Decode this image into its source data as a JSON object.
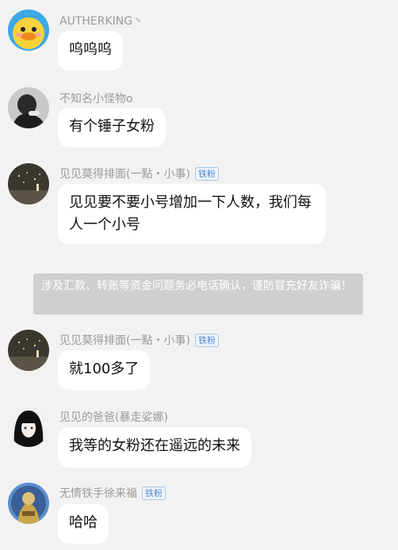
{
  "messages": [
    {
      "name": "AUTHERKING丶",
      "badge": "",
      "text": "呜呜呜",
      "avatar": "duck-avatar"
    },
    {
      "name": "不知名小怪物o",
      "badge": "",
      "text": "有个锤子女粉",
      "avatar": "hooded-person-avatar"
    },
    {
      "name": "见见莫得排面(一點・小事)",
      "badge": "铁粉",
      "text": "见见要不要小号增加一下人数，我们每人一个小号",
      "avatar": "dark-night-avatar"
    },
    {
      "name": "见见莫得排面(一點・小事)",
      "badge": "铁粉",
      "text": "就100多了",
      "avatar": "dark-night-avatar"
    },
    {
      "name": "见见的爸爸(暴走娑娜)",
      "badge": "",
      "text": "我等的女粉还在遥远的未来",
      "avatar": "anime-girl-avatar"
    },
    {
      "name": "无情铁手徐来福",
      "badge": "铁粉",
      "text": "哈哈",
      "avatar": "warrior-avatar"
    }
  ],
  "notice": "涉及汇款、转账等资金问题务必电话确认，谨防冒充好友诈骗！",
  "colors": {
    "background": "#f2f2f2",
    "bubble": "#ffffff",
    "notice_bg": "#cfcfcf",
    "badge_text": "#4f88c9"
  }
}
